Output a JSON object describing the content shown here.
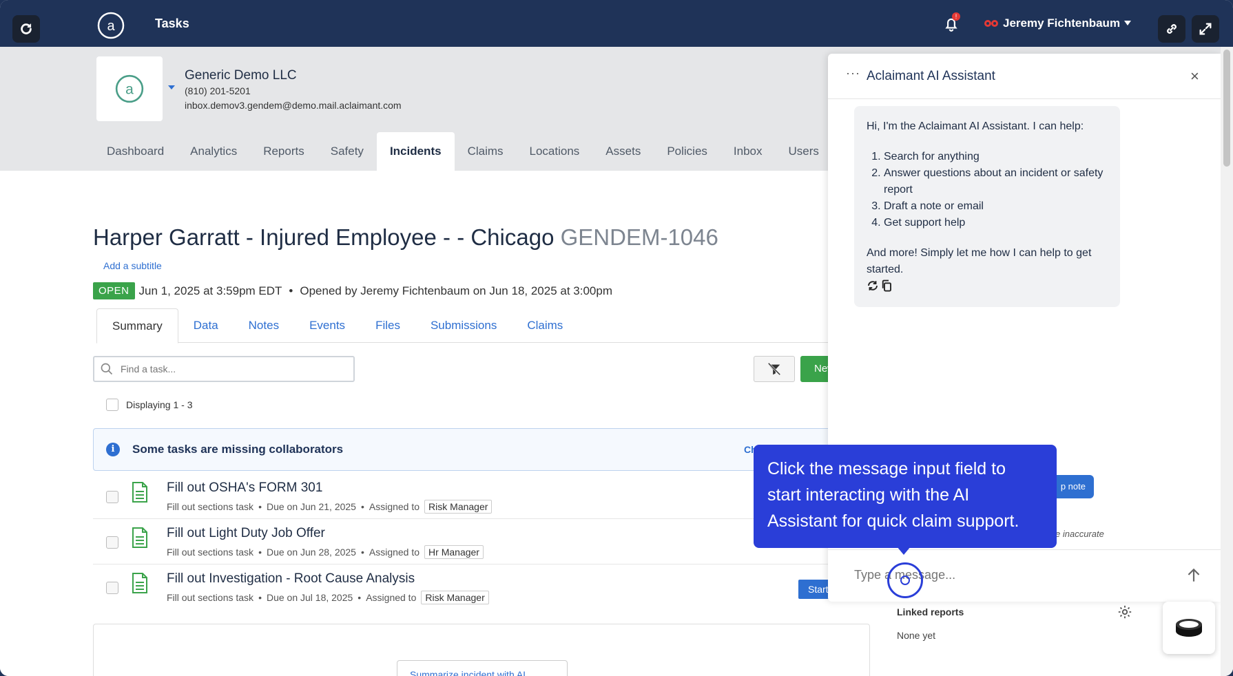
{
  "app": {
    "title": "Tasks",
    "user_name": "Jeremy Fichtenbaum",
    "notification_count": "!"
  },
  "company": {
    "name": "Generic Demo LLC",
    "phone": "(810) 201-5201",
    "email": "inbox.demov3.gendem@demo.mail.aclaimant.com"
  },
  "nav": [
    "Dashboard",
    "Analytics",
    "Reports",
    "Safety",
    "Incidents",
    "Claims",
    "Locations",
    "Assets",
    "Policies",
    "Inbox",
    "Users"
  ],
  "nav_active": "Incidents",
  "incident": {
    "title": "Harper Garratt - Injured Employee - - Chicago",
    "code": "GENDEM-1046",
    "subtitle_link": "Add a subtitle",
    "status": "OPEN",
    "date": "Jun 1, 2025 at 3:59pm EDT",
    "opened_by": "Opened by Jeremy Fichtenbaum on Jun 18, 2025 at 3:00pm",
    "separator": "•"
  },
  "subtabs": [
    "Summary",
    "Data",
    "Notes",
    "Events",
    "Files",
    "Submissions",
    "Claims"
  ],
  "tasks_section": {
    "search_placeholder": "Find a task...",
    "new_label": "New",
    "displaying": "Displaying 1 - 3",
    "alert_text": "Some tasks are missing collaborators",
    "alert_link": "Ch",
    "items": [
      {
        "title": "Fill out OSHA's FORM 301",
        "type": "Fill out sections task",
        "due": "Due on Jun 21, 2025",
        "assigned_label": "Assigned to",
        "role": "Risk Manager",
        "action": ""
      },
      {
        "title": "Fill out Light Duty Job Offer",
        "type": "Fill out sections task",
        "due": "Due on Jun 28, 2025",
        "assigned_label": "Assigned to",
        "role": "Hr Manager",
        "action": ""
      },
      {
        "title": "Fill out Investigation - Root Cause Analysis",
        "type": "Fill out sections task",
        "due": "Due on Jul 18, 2025",
        "assigned_label": "Assigned to",
        "role": "Risk Manager",
        "action": "Start"
      }
    ],
    "summarize_label": "Summarize incident with AI"
  },
  "linked_reports": {
    "label": "Linked reports",
    "value": "None yet"
  },
  "assistant": {
    "title": "Aclaimant AI Assistant",
    "greeting": "Hi, I'm the Aclaimant AI Assistant. I can help:",
    "capabilities": [
      "Search for anything",
      "Answer questions about an incident or safety report",
      "Draft a note or email",
      "Get support help"
    ],
    "closing": "And more! Simply let me how I can help to get started.",
    "pill_label": "p note",
    "disclaimer": "e inaccurate",
    "input_placeholder": "Type a message..."
  },
  "tooltip": {
    "text": "Click the message input field to start interacting with the AI Assistant for quick claim support."
  },
  "colors": {
    "topbar": "#1f3358",
    "accent": "#2e6fd1",
    "open_green": "#3aa34a",
    "tooltip": "#2a3ed8"
  }
}
